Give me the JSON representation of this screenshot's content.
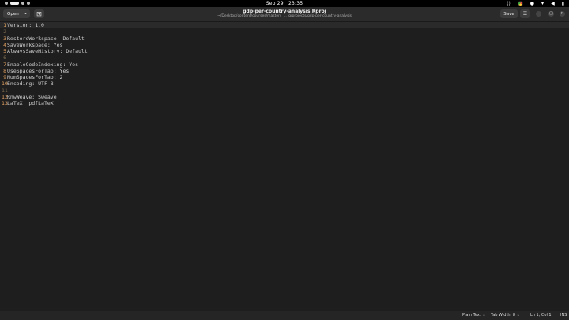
{
  "system": {
    "date": "Sep 29",
    "time": "23:35"
  },
  "header": {
    "open_label": "Open",
    "title": "gdp-per-country-analysis.Rproj",
    "path": "~/Desktop/content/courses/masters_..._g/projects/gdp-per-country-analysis",
    "save_label": "Save"
  },
  "editor": {
    "lines": [
      {
        "num": "1",
        "text": "Version: 1.0"
      },
      {
        "num": "2",
        "text": ""
      },
      {
        "num": "3",
        "text": "RestoreWorkspace: Default"
      },
      {
        "num": "4",
        "text": "SaveWorkspace: Yes"
      },
      {
        "num": "5",
        "text": "AlwaysSaveHistory: Default"
      },
      {
        "num": "6",
        "text": ""
      },
      {
        "num": "7",
        "text": "EnableCodeIndexing: Yes"
      },
      {
        "num": "8",
        "text": "UseSpacesForTab: Yes"
      },
      {
        "num": "9",
        "text": "NumSpacesForTab: 2"
      },
      {
        "num": "10",
        "text": "Encoding: UTF-8"
      },
      {
        "num": "11",
        "text": ""
      },
      {
        "num": "12",
        "text": "RnwWeave: Sweave"
      },
      {
        "num": "13",
        "text": "LaTeX: pdfLaTeX"
      }
    ]
  },
  "status": {
    "language": "Plain Text",
    "tab_width": "Tab Width: 8",
    "position": "Ln 1, Col 1",
    "mode": "INS"
  }
}
